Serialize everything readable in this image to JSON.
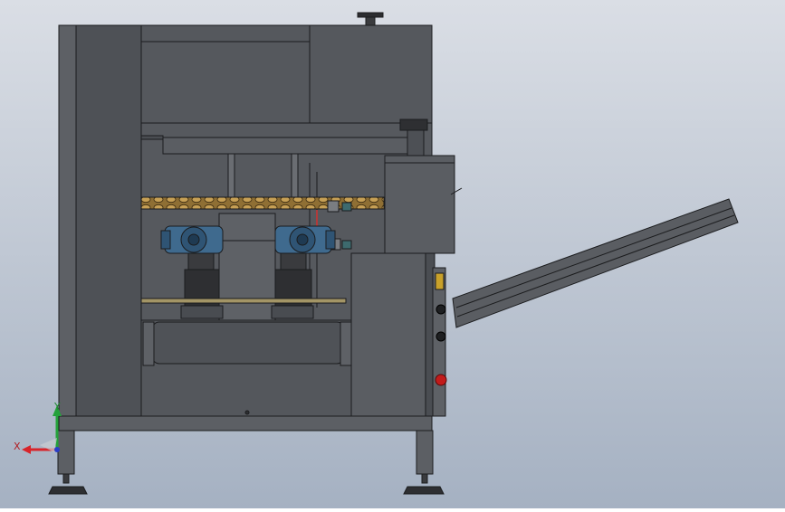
{
  "viewport": {
    "background_top": "#d9dde4",
    "background_bottom": "#a7b3c4",
    "part_color": "#5b5e63",
    "edge_color": "#1b1c1e",
    "chain_color": "#b08a44",
    "motor_color": "#3f6a8e"
  },
  "triad": {
    "x_label": "X",
    "y_label": "Y",
    "x_color": "#d8242a",
    "y_color": "#24a13a",
    "z_color": "#2a3ec9"
  },
  "components": {
    "estop_color": "#c21b1b",
    "indicator_color": "#c9a12a"
  }
}
